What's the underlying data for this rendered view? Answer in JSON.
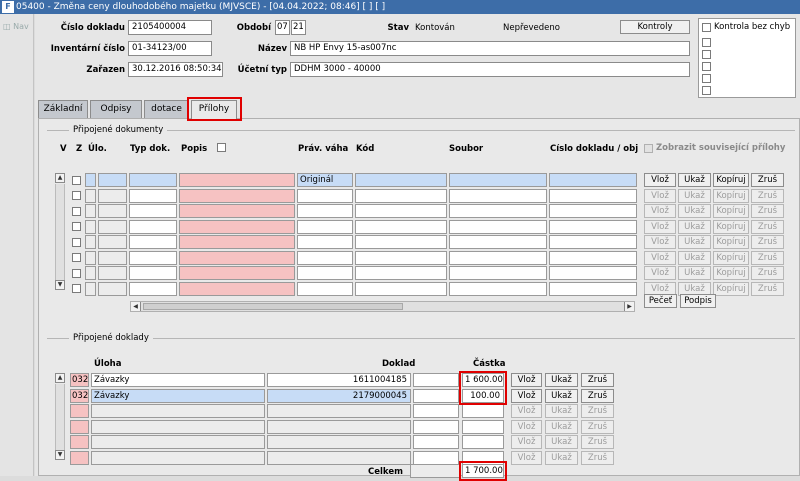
{
  "window": {
    "title": "05400 - Změna ceny dlouhodobého majetku (MJVSCE) - [04.04.2022; 08:46]  [ ]  [ ]",
    "icon": "app-icon"
  },
  "leftnav": {
    "label": "Nav"
  },
  "header": {
    "cislo_dokladu_label": "Číslo dokladu",
    "cislo_dokladu": "2105400004",
    "obdobi_label": "Období",
    "obdobi_month": "07",
    "obdobi_year": "21",
    "stav_label": "Stav",
    "stav_value": "Kontován",
    "neprevedeno": "Nepřevedeno",
    "kontroly_button": "Kontroly",
    "inventarni_cislo_label": "Inventární číslo",
    "inventarni_cislo": "01-34123/00",
    "nazev_label": "Název",
    "nazev": "NB HP Envy 15-as007nc",
    "zarazen_label": "Zařazen",
    "zarazen": "30.12.2016 08:50:34",
    "ucetni_typ_label": "Účetní typ",
    "ucetni_typ": "DDHM 3000 - 40000",
    "kontrola_bez_chyb": "Kontrola bez chyb"
  },
  "tabs": [
    "Základní",
    "Odpisy",
    "dotace",
    "Přílohy"
  ],
  "pripojene_dokumenty": {
    "title": "Připojené dokumenty",
    "columns": {
      "v": "V",
      "z": "Z",
      "ulo": "Úlo.",
      "typ_dok": "Typ dok.",
      "popis": "Popis",
      "prav_vaha": "Práv. váha",
      "kod": "Kód",
      "soubor": "Soubor",
      "cislo_dokladu": "Číslo dokladu / obje"
    },
    "first_row_prav_vaha": "Originál",
    "zobrazit_souvisejici": "Zobrazit související přílohy",
    "row_buttons": {
      "vloz": "Vlož",
      "ukaz": "Ukaž",
      "kopiruj": "Kopíruj",
      "zrus": "Zruš"
    },
    "pecet_button": "Pečeť",
    "podpis_button": "Podpis"
  },
  "pripojene_doklady": {
    "title": "Připojené doklady",
    "columns": {
      "uloha": "Úloha",
      "doklad": "Doklad",
      "castka": "Částka"
    },
    "rows": [
      {
        "kod": "032",
        "uloha": "Závazky",
        "doklad": "1611004185",
        "castka": "1 600.00"
      },
      {
        "kod": "032",
        "uloha": "Závazky",
        "doklad": "2179000045",
        "castka": "100.00"
      }
    ],
    "row_buttons": {
      "vloz": "Vlož",
      "ukaz": "Ukaž",
      "zrus": "Zruš"
    },
    "celkem_label": "Celkem",
    "celkem": "1 700.00"
  },
  "colors": {
    "titlebar": "#3d6da8",
    "highlight": "#e00000",
    "selected_row": "#c7dcf6",
    "required_field": "#f6c2c2"
  }
}
